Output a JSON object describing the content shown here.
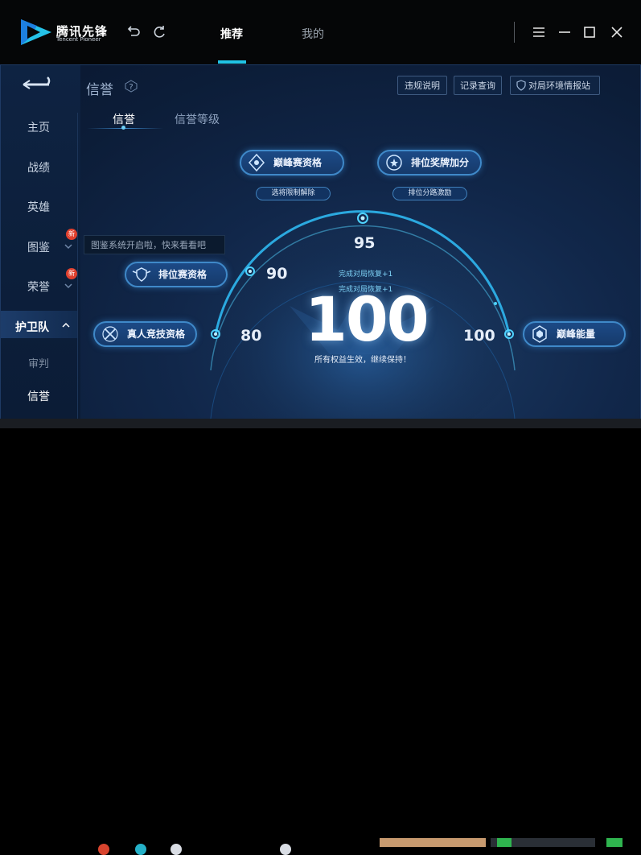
{
  "brand": {
    "name": "腾讯先锋",
    "subtitle": "Tencent Pioneer"
  },
  "titlebar": {
    "tabs": [
      {
        "label": "推荐",
        "active": true
      },
      {
        "label": "我的",
        "active": false
      }
    ],
    "icons": [
      "undo-icon",
      "refresh-icon",
      "menu-icon",
      "minimize-icon",
      "maximize-icon",
      "close-icon"
    ]
  },
  "sidebar": {
    "items": [
      {
        "label": "主页"
      },
      {
        "label": "战绩"
      },
      {
        "label": "英雄"
      },
      {
        "label": "图鉴",
        "badge": "新"
      },
      {
        "label": "荣誉",
        "badge": "新"
      },
      {
        "label": "护卫队"
      },
      {
        "label": "审判"
      },
      {
        "label": "信誉",
        "active": true
      }
    ],
    "tooltip": "图鉴系统开启啦，快来看看吧"
  },
  "header": {
    "title": "信誉",
    "buttons": [
      "违规说明",
      "记录查询",
      "对局环境情报站"
    ]
  },
  "subtabs": [
    {
      "label": "信誉",
      "active": true
    },
    {
      "label": "信誉等级",
      "active": false
    }
  ],
  "privileges": {
    "peak_qualification": "巅峰赛资格",
    "rank_medal_bonus": "排位奖牌加分",
    "select_restriction": "选将限制解除",
    "rank_lane_incentive": "排位分路激励",
    "rank_qualification": "排位赛资格",
    "real_competition": "真人竞技资格",
    "peak_energy": "巅峰能量"
  },
  "gauge": {
    "score": "100",
    "thresholds": [
      "80",
      "90",
      "95",
      "100"
    ],
    "recovery_lines": [
      "完成对局恢复+1",
      "完成对局恢复+1"
    ],
    "status": "所有权益生效，继续保持！",
    "accent": "#2fb7f0"
  }
}
